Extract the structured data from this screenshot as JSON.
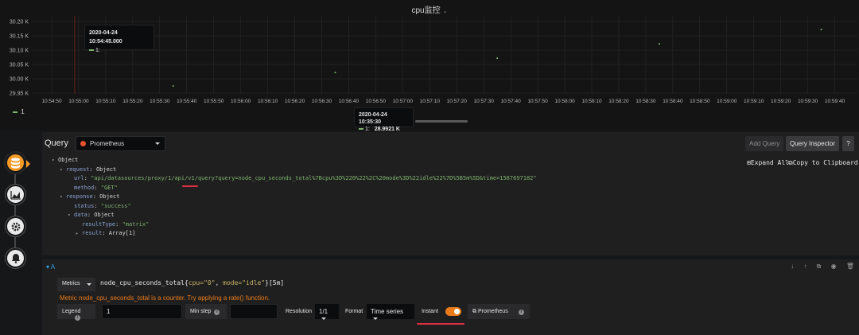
{
  "panel": {
    "title": "cpu监控"
  },
  "chart_data": {
    "type": "scatter",
    "title": "cpu监控",
    "y_ticks": [
      "30.20 K",
      "30.15 K",
      "30.10 K",
      "30.05 K",
      "30.00 K",
      "29.95 K"
    ],
    "ylim": [
      29.95,
      30.2
    ],
    "x_ticks": [
      "10:54:50",
      "10:55:00",
      "10:55:10",
      "10:55:20",
      "10:55:30",
      "10:55:40",
      "10:55:50",
      "10:56:00",
      "10:56:10",
      "10:56:20",
      "10:56:30",
      "10:56:40",
      "10:56:50",
      "10:57:00",
      "10:57:10",
      "10:57:20",
      "10:57:30",
      "10:57:40",
      "10:57:50",
      "10:58:00",
      "10:58:10",
      "10:58:20",
      "10:58:30",
      "10:58:40",
      "10:58:50",
      "10:59:00",
      "10:59:10",
      "10:59:20",
      "10:59:30",
      "10:59:40"
    ],
    "series": [
      {
        "name": "1",
        "color": "#7eb26d",
        "x_seconds_after_10_54_50": [
          45,
          105,
          165,
          225,
          285
        ],
        "values": [
          29.975,
          30.022,
          30.072,
          30.122,
          30.172
        ]
      }
    ],
    "grid": true,
    "legend": "bottom-left"
  },
  "tooltip_top": {
    "time": "2020-04-24 10:54:45.000",
    "series": "1:"
  },
  "tooltip_bottom": {
    "time": "2020-04-24 10:35:30",
    "series": "1:",
    "value": "28.9921 K"
  },
  "legend": {
    "label": "1"
  },
  "query": {
    "title": "Query",
    "datasource": "Prometheus",
    "add_query": "Add Query",
    "inspector": "Query Inspector",
    "help": "?"
  },
  "inspector": {
    "expand_all": "Expand All",
    "copy": "Copy to Clipboard",
    "root": "Object",
    "request_key": "request",
    "request_type": "Object",
    "url_key": "url",
    "url_val": "\"api/datasources/proxy/1/api/v1/query?query=node_cpu_seconds_total%7Bcpu%3D%220%22%2C%20mode%3D%22idle%22%7D%5B5m%5D&time=1587697182\"",
    "method_key": "method",
    "method_val": "\"GET\"",
    "response_key": "response",
    "response_type": "Object",
    "status_key": "status",
    "status_val": "\"success\"",
    "data_key": "data",
    "data_type": "Object",
    "resulttype_key": "resultType",
    "resulttype_val": "\"matrix\"",
    "result_key": "result",
    "result_val": "Array[1]"
  },
  "rowA": {
    "name": "A",
    "metrics_btn": "Metrics",
    "expr_metric": "node_cpu_seconds_total",
    "expr_open": "{",
    "expr_label1": "cpu=\"0\"",
    "expr_sep": ", ",
    "expr_label2": "mode=\"idle\"",
    "expr_close": "}[5m]",
    "warning": "Metric node_cpu_seconds_total is a counter. Try applying a rate() function.",
    "legend_label": "Legend",
    "legend_value": "1",
    "minstep_label": "Min step",
    "minstep_value": "",
    "resolution_label": "Resolution",
    "resolution_value": "1/1",
    "format_label": "Format",
    "format_value": "Time series",
    "instant_label": "Instant",
    "instant_on": true,
    "prom_link": "Prometheus"
  }
}
